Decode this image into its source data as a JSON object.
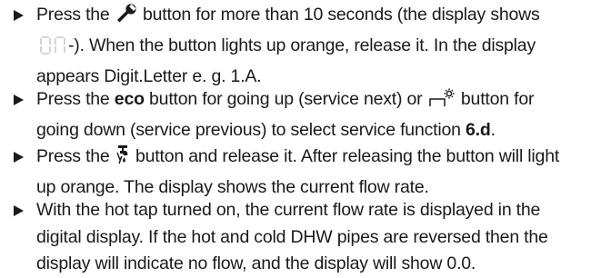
{
  "icons": {
    "wrench": "wrench-icon",
    "segment_display": "seven-segment-display-icon",
    "sun_down": "temperature-down-sun-icon",
    "tap": "hot-water-tap-icon"
  },
  "colors": {
    "text": "#1a1a1a",
    "segment_dim": "#c8c8c8"
  },
  "items": [
    {
      "l1a": "Press the",
      "l1b": "button for more than 10 seconds (the display shows",
      "l2a": "-). When the button lights up orange, release it. In the display",
      "l3": "appears Digit.Letter e. g. 1.A."
    },
    {
      "l1a": "Press the",
      "l1b": "eco",
      "l1c": "button for going up (service next) or",
      "l1d": "button for",
      "l2a": "going down (service previous) to select service function",
      "l2b": "6.d",
      "l2c": "."
    },
    {
      "l1a": "Press the",
      "l1b": "button and release it. After releasing the button will light",
      "l2": "up orange. The display shows the current flow rate."
    },
    {
      "l1": "With the hot tap turned on, the current flow rate is displayed in the",
      "l2": "digital display. If the hot and cold DHW pipes are reversed then the",
      "l3": "display will indicate no flow, and the display will show 0.0."
    }
  ]
}
